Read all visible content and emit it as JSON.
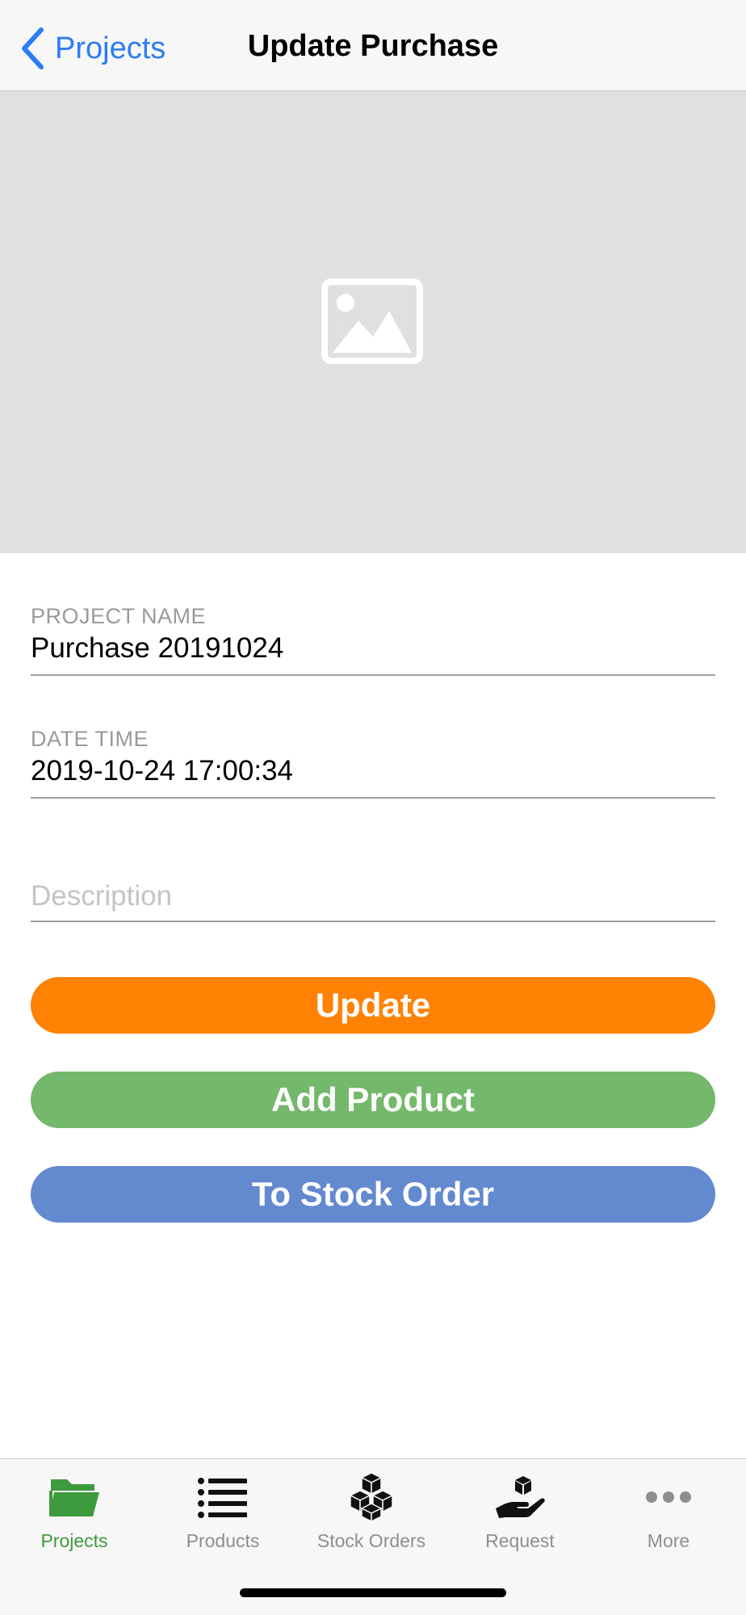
{
  "navbar": {
    "back_label": "Projects",
    "title": "Update Purchase"
  },
  "image": {
    "icon": "image-placeholder-icon"
  },
  "form": {
    "project_name": {
      "label": "PROJECT NAME",
      "value": "Purchase 20191024"
    },
    "date_time": {
      "label": "DATE TIME",
      "value": "2019-10-24 17:00:34"
    },
    "description": {
      "placeholder": "Description",
      "value": ""
    }
  },
  "buttons": {
    "update": {
      "label": "Update",
      "color": "#ff8205"
    },
    "add_product": {
      "label": "Add Product",
      "color": "#74b86b"
    },
    "to_stock_order": {
      "label": "To Stock Order",
      "color": "#6389cf"
    }
  },
  "tabbar": {
    "active_color": "#3d9a3d",
    "items": [
      {
        "label": "Projects",
        "icon": "folder-icon",
        "active": true
      },
      {
        "label": "Products",
        "icon": "list-icon",
        "active": false
      },
      {
        "label": "Stock Orders",
        "icon": "boxes-icon",
        "active": false
      },
      {
        "label": "Request",
        "icon": "hand-box-icon",
        "active": false
      },
      {
        "label": "More",
        "icon": "more-dots-icon",
        "active": false
      }
    ]
  }
}
